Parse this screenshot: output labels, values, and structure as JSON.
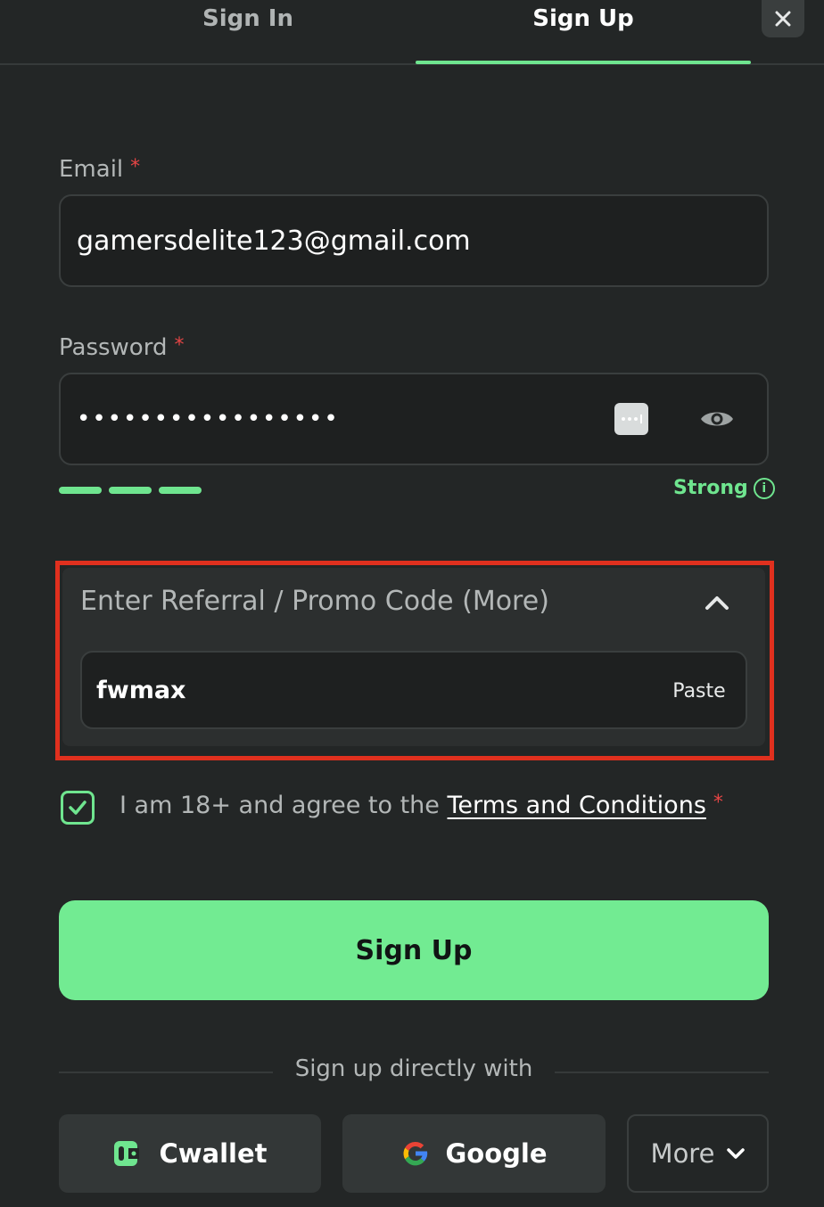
{
  "tabs": {
    "sign_in": "Sign In",
    "sign_up": "Sign Up",
    "active": "sign_up"
  },
  "close_icon": "close-icon",
  "email": {
    "label": "Email",
    "required_mark": "*",
    "value": "gamersdelite123@gmail.com"
  },
  "password": {
    "label": "Password",
    "required_mark": "*",
    "masked_value": "•••••••••••••••••",
    "strength_text": "Strong",
    "strength_info": "i",
    "strength_level": 3,
    "strength_max": 3
  },
  "referral": {
    "title": "Enter Referral / Promo Code (More)",
    "value": "fwmax",
    "paste_label": "Paste",
    "expanded": true
  },
  "terms": {
    "text_before": "I am 18+ and agree to the ",
    "link_text": "Terms and Conditions",
    "required_mark": "*",
    "checked": true
  },
  "signup_button": "Sign Up",
  "divider_text": "Sign up directly with",
  "social": {
    "cwallet": "Cwallet",
    "google": "Google",
    "more": "More"
  },
  "colors": {
    "accent_green": "#6fe58f",
    "button_green": "#72eb92",
    "background": "#232626",
    "required_red": "#e64545",
    "highlight_red": "#e0301e"
  }
}
